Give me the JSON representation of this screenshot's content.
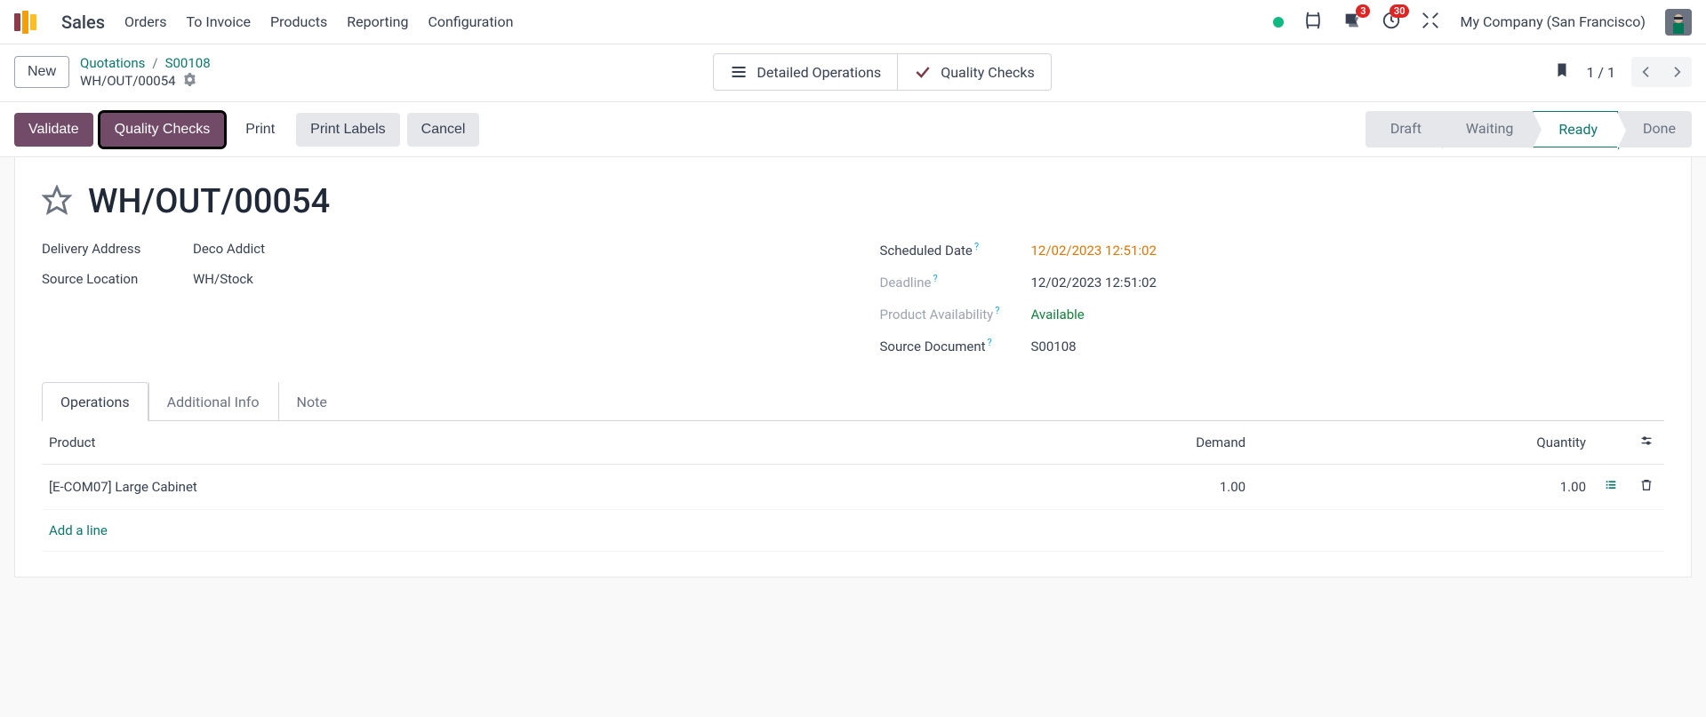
{
  "app": {
    "name": "Sales"
  },
  "nav": {
    "items": [
      "Orders",
      "To Invoice",
      "Products",
      "Reporting",
      "Configuration"
    ]
  },
  "topright": {
    "messages_badge": "3",
    "activities_badge": "30",
    "company": "My Company (San Francisco)"
  },
  "cp": {
    "new": "New",
    "breadcrumb": {
      "quotations": "Quotations",
      "order": "S00108",
      "record": "WH/OUT/00054"
    },
    "stat_detailed": "Detailed Operations",
    "stat_quality": "Quality Checks",
    "pager": "1 / 1"
  },
  "actions": {
    "validate": "Validate",
    "quality_checks": "Quality Checks",
    "print": "Print",
    "print_labels": "Print Labels",
    "cancel": "Cancel"
  },
  "status": {
    "draft": "Draft",
    "waiting": "Waiting",
    "ready": "Ready",
    "done": "Done"
  },
  "record": {
    "title": "WH/OUT/00054",
    "delivery_address_label": "Delivery Address",
    "delivery_address": "Deco Addict",
    "source_location_label": "Source Location",
    "source_location": "WH/Stock",
    "scheduled_date_label": "Scheduled Date",
    "scheduled_date": "12/02/2023 12:51:02",
    "deadline_label": "Deadline",
    "deadline": "12/02/2023 12:51:02",
    "availability_label": "Product Availability",
    "availability": "Available",
    "source_doc_label": "Source Document",
    "source_doc": "S00108"
  },
  "tabs": {
    "operations": "Operations",
    "additional": "Additional Info",
    "note": "Note"
  },
  "table": {
    "headers": {
      "product": "Product",
      "demand": "Demand",
      "quantity": "Quantity"
    },
    "rows": [
      {
        "product": "[E-COM07] Large Cabinet",
        "demand": "1.00",
        "quantity": "1.00"
      }
    ],
    "add_line": "Add a line"
  }
}
